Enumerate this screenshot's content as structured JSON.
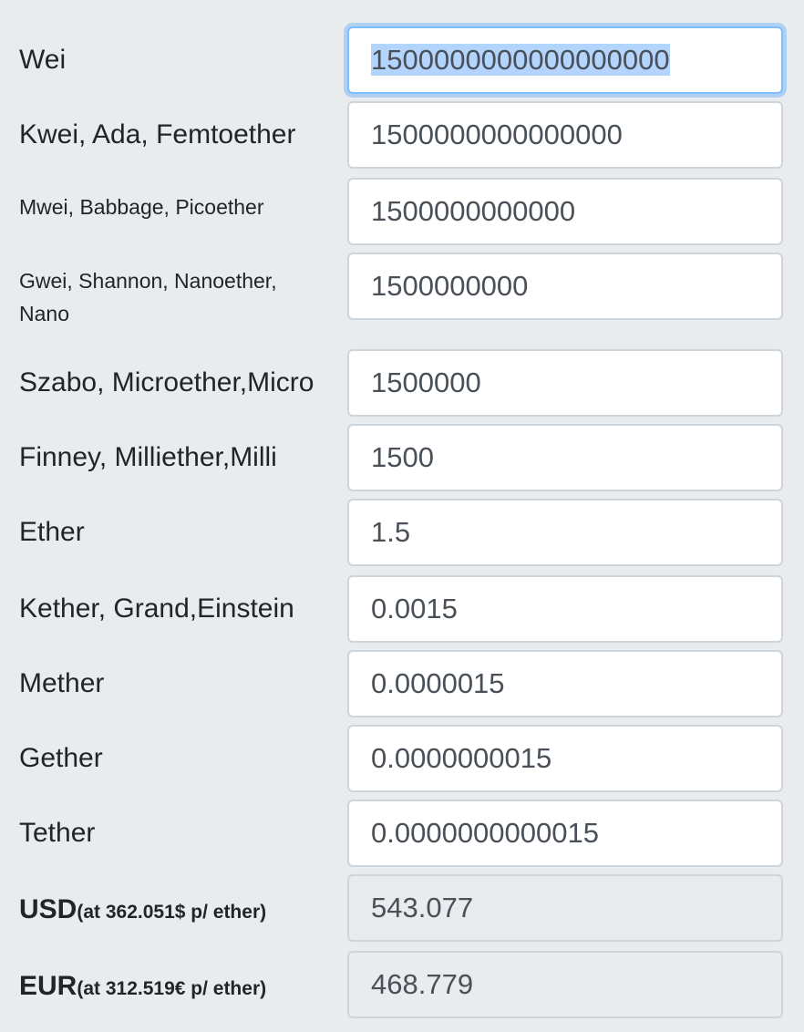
{
  "units": [
    {
      "label": "Wei",
      "value": "1500000000000000000"
    },
    {
      "label": "Kwei, Ada, Femtoether",
      "value": "1500000000000000"
    },
    {
      "label": "Mwei, Babbage, Picoether",
      "value": "1500000000000"
    },
    {
      "label_line1": "Gwei, Shannon, Nanoether,",
      "label_line2": "Nano",
      "value": "1500000000"
    },
    {
      "label": "Szabo, Microether,Micro",
      "value": "1500000"
    },
    {
      "label": "Finney, Milliether,Milli",
      "value": "1500"
    },
    {
      "label": "Ether",
      "value": "1.5"
    },
    {
      "label": "Kether, Grand,Einstein",
      "value": "0.0015"
    },
    {
      "label": "Mether",
      "value": "0.0000015"
    },
    {
      "label": "Gether",
      "value": "0.0000000015"
    },
    {
      "label": "Tether",
      "value": "0.0000000000015"
    }
  ],
  "fiat": [
    {
      "currency": "USD",
      "rate_note": "(at 362.051$ p/ ether)",
      "value": "543.077"
    },
    {
      "currency": "EUR",
      "rate_note": "(at 312.519€ p/ ether)",
      "value": "468.779"
    }
  ]
}
